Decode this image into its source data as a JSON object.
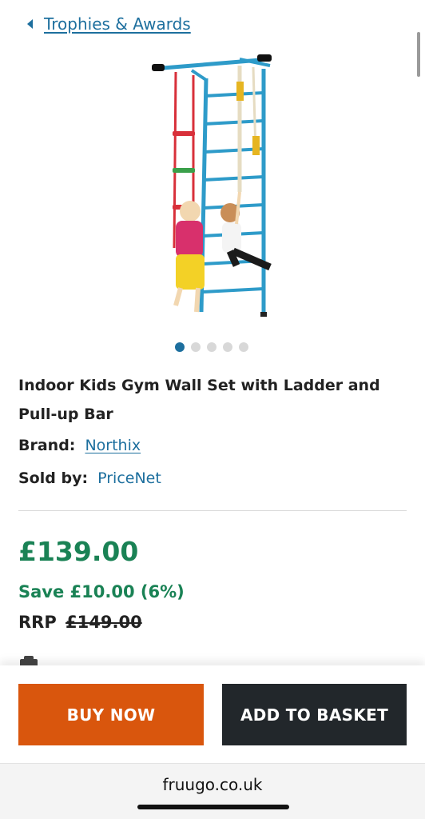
{
  "breadcrumb": {
    "label": "Trophies & Awards"
  },
  "carousel": {
    "slide_count": 5,
    "active_index": 0
  },
  "product": {
    "title": "Indoor Kids Gym Wall Set with Ladder and Pull-up Bar",
    "brand_label": "Brand:",
    "brand_value": "Northix",
    "sold_by_label": "Sold by:",
    "sold_by_value": "PriceNet"
  },
  "pricing": {
    "price": "£139.00",
    "save": "Save £10.00 (6%)",
    "rrp_label": "RRP",
    "rrp_value": "£149.00"
  },
  "actions": {
    "buy_now": "BUY NOW",
    "add_to_basket": "ADD TO BASKET"
  },
  "browser": {
    "domain": "fruugo.co.uk"
  },
  "colors": {
    "link": "#1d6f9e",
    "price_green": "#1a8255",
    "buy_orange": "#d9560d",
    "basket_dark": "#22272b"
  },
  "icons": {
    "breadcrumb": "chevron-left-icon"
  }
}
